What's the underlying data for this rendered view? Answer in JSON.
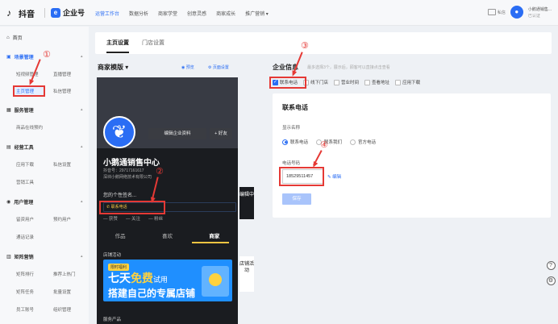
{
  "topbar": {
    "logo_text": "抖音",
    "brand2": "企业号",
    "nav": [
      "运营工作台",
      "数据分析",
      "商家学堂",
      "创意灵感",
      "商家成长",
      "推广营销 ▾"
    ],
    "active_nav": 0,
    "msg_label": "私信",
    "user_name": "小鹅通销售...",
    "user_sub": "已认证"
  },
  "sidebar": {
    "home": "首页",
    "sections": [
      {
        "label": "场景管理",
        "active": true,
        "items": [
          [
            "短视频管理",
            "直播管理"
          ],
          [
            "主页管理",
            "私信管理"
          ]
        ]
      },
      {
        "label": "服务管理",
        "active": false,
        "items": [
          [
            "商品在线预约"
          ]
        ]
      },
      {
        "label": "经营工具",
        "active": false,
        "items": [
          [
            "应用下载",
            "私信设置"
          ],
          [
            "营销工具"
          ]
        ]
      },
      {
        "label": "用户管理",
        "active": false,
        "items": [
          [
            "留资用户",
            "预约用户"
          ],
          [
            "通话记录"
          ]
        ]
      },
      {
        "label": "矩阵营销",
        "active": false,
        "items": [
          [
            "矩阵排行",
            "推荐上热门"
          ],
          [
            "矩阵任务",
            "批量设置"
          ],
          [
            "员工账号",
            "组织管理"
          ]
        ]
      }
    ]
  },
  "tabs": {
    "home": "主页设置",
    "store": "门店设置"
  },
  "template": {
    "title": "商家模版 ▾",
    "preview": "◉ 预览",
    "page_settings": "⚙ 页面设置"
  },
  "phone": {
    "edit_profile": "编辑企业资料",
    "follow": "+ 好友",
    "name": "小鹅通销售中心",
    "douyin_id": "抖音号：29717161617",
    "company": "深圳小鹅网络技术有限公司",
    "signature": "您的个性签名...",
    "contact": "✆ 联系电话",
    "stats": [
      "— 获赞",
      "— 关注",
      "— 粉丝"
    ],
    "tabs": [
      "作品",
      "喜欢",
      "商家"
    ],
    "store_label": "店铺活动",
    "banner_tag": "限时福利",
    "banner_l1a": "七天",
    "banner_l1b": "免费",
    "banner_l1c": "试用",
    "banner_l2": "搭建自己的专属店铺",
    "service_label": "服务产品"
  },
  "vtabs": {
    "edit": "编辑中",
    "store": "店铺活动"
  },
  "enterprise": {
    "title": "企业信息",
    "hint": "最多选择3个，展示后，顾客可以直接点击查看",
    "checkboxes": [
      {
        "label": "联系电话",
        "checked": true
      },
      {
        "label": "线下门店",
        "checked": false
      },
      {
        "label": "营业时间",
        "checked": false
      },
      {
        "label": "查看地址",
        "checked": false
      },
      {
        "label": "应用下载",
        "checked": false
      }
    ]
  },
  "phone_card": {
    "title": "联系电话",
    "display_label": "显示名称",
    "radios": [
      {
        "label": "联系电话",
        "on": true
      },
      {
        "label": "联系我们",
        "on": false
      },
      {
        "label": "官方电话",
        "on": false
      }
    ],
    "phone_label": "电话号码",
    "phone_value": "18529511457",
    "edit": "✎ 编辑",
    "save": "保存"
  },
  "annotations": [
    "①",
    "②",
    "③",
    "④"
  ],
  "rail": [
    "?",
    "⚙"
  ],
  "colors": {
    "accent": "#2a6df4",
    "annotation": "#e53935"
  }
}
